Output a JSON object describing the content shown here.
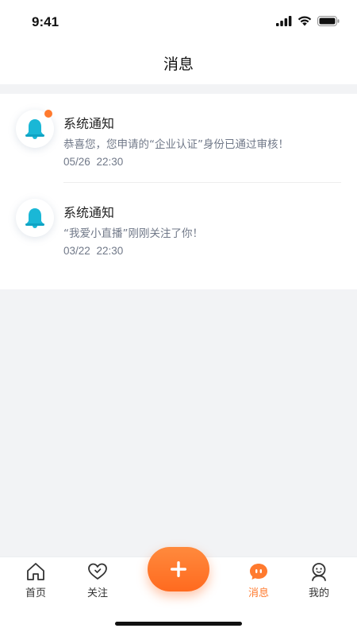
{
  "status_bar": {
    "time": "9:41",
    "icons": [
      "signal-icon",
      "wifi-icon",
      "battery-icon"
    ]
  },
  "header": {
    "title": "消息"
  },
  "messages": [
    {
      "icon": "bell-icon",
      "title": "系统通知",
      "body": "恭喜您，您申请的“企业认证”身份已通过审核！",
      "time": "05/26 22:30",
      "unread": true
    },
    {
      "icon": "bell-icon",
      "title": "系统通知",
      "body": "“我爱小直播”刚刚关注了你！",
      "time": "03/22 22:30",
      "unread": false
    }
  ],
  "tab_bar": {
    "items": [
      {
        "label": "首页",
        "icon": "home-icon",
        "active": false
      },
      {
        "label": "关注",
        "icon": "heart-icon",
        "active": false
      },
      {
        "label": "消息",
        "icon": "chat-icon",
        "active": true
      },
      {
        "label": "我的",
        "icon": "profile-icon",
        "active": false
      }
    ],
    "center_button_icon": "plus-icon"
  },
  "colors": {
    "accent": "#ff7a2e",
    "bell": "#1ab7d6",
    "background": "#f2f3f5",
    "text_secondary": "#707888"
  }
}
